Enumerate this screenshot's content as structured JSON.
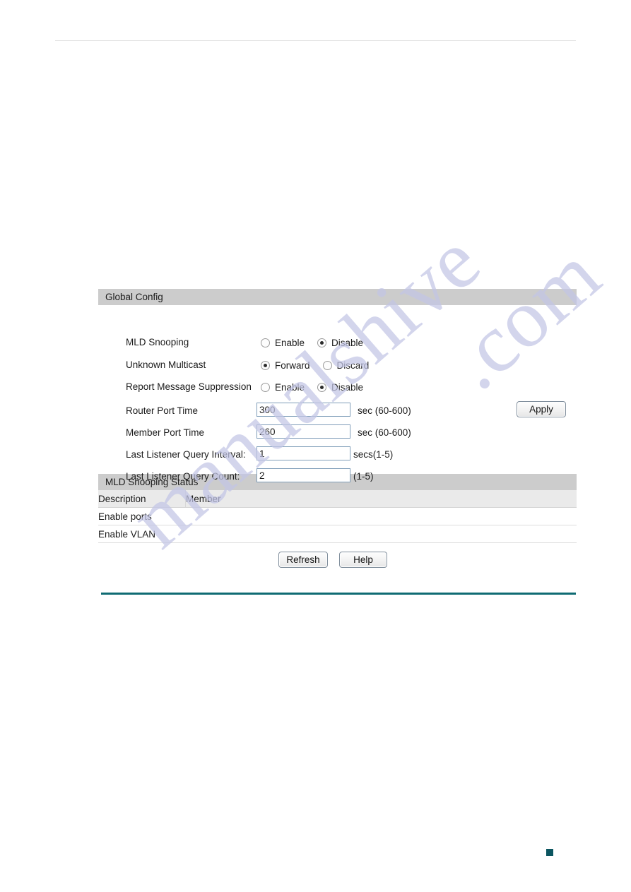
{
  "page": {
    "corner_mark_color": "#0c5560",
    "rule_color": "#0f6b73",
    "watermark_text_1": "manualshive",
    "watermark_text_2": ".com"
  },
  "global_config": {
    "title": "Global Config",
    "rows": [
      {
        "label": "MLD Snooping",
        "type": "radio",
        "options": [
          {
            "label": "Enable",
            "selected": false
          },
          {
            "label": "Disable",
            "selected": true
          }
        ]
      },
      {
        "label": "Unknown Multicast",
        "type": "radio",
        "options": [
          {
            "label": "Forward",
            "selected": true
          },
          {
            "label": "Discard",
            "selected": false
          }
        ]
      },
      {
        "label": "Report Message Suppression",
        "type": "radio",
        "options": [
          {
            "label": "Enable",
            "selected": false
          },
          {
            "label": "Disable",
            "selected": true
          }
        ]
      },
      {
        "label": "Router Port Time",
        "type": "text",
        "value": "300",
        "unit": "sec (60-600)"
      },
      {
        "label": "Member Port Time",
        "type": "text",
        "value": "260",
        "unit": "sec (60-600)"
      },
      {
        "label": "Last Listener Query Interval:",
        "type": "text",
        "value": "1",
        "unit": "secs(1-5)"
      },
      {
        "label": "Last Listener Query Count:",
        "type": "text",
        "value": "2",
        "unit": "(1-5)"
      }
    ],
    "apply_label": "Apply"
  },
  "status_table": {
    "title": "MLD Snooping Status",
    "columns": [
      "Description",
      "Member"
    ],
    "rows": [
      {
        "description": "Enable ports",
        "member": ""
      },
      {
        "description": "Enable VLAN",
        "member": ""
      }
    ]
  },
  "footer": {
    "refresh_label": "Refresh",
    "help_label": "Help"
  }
}
